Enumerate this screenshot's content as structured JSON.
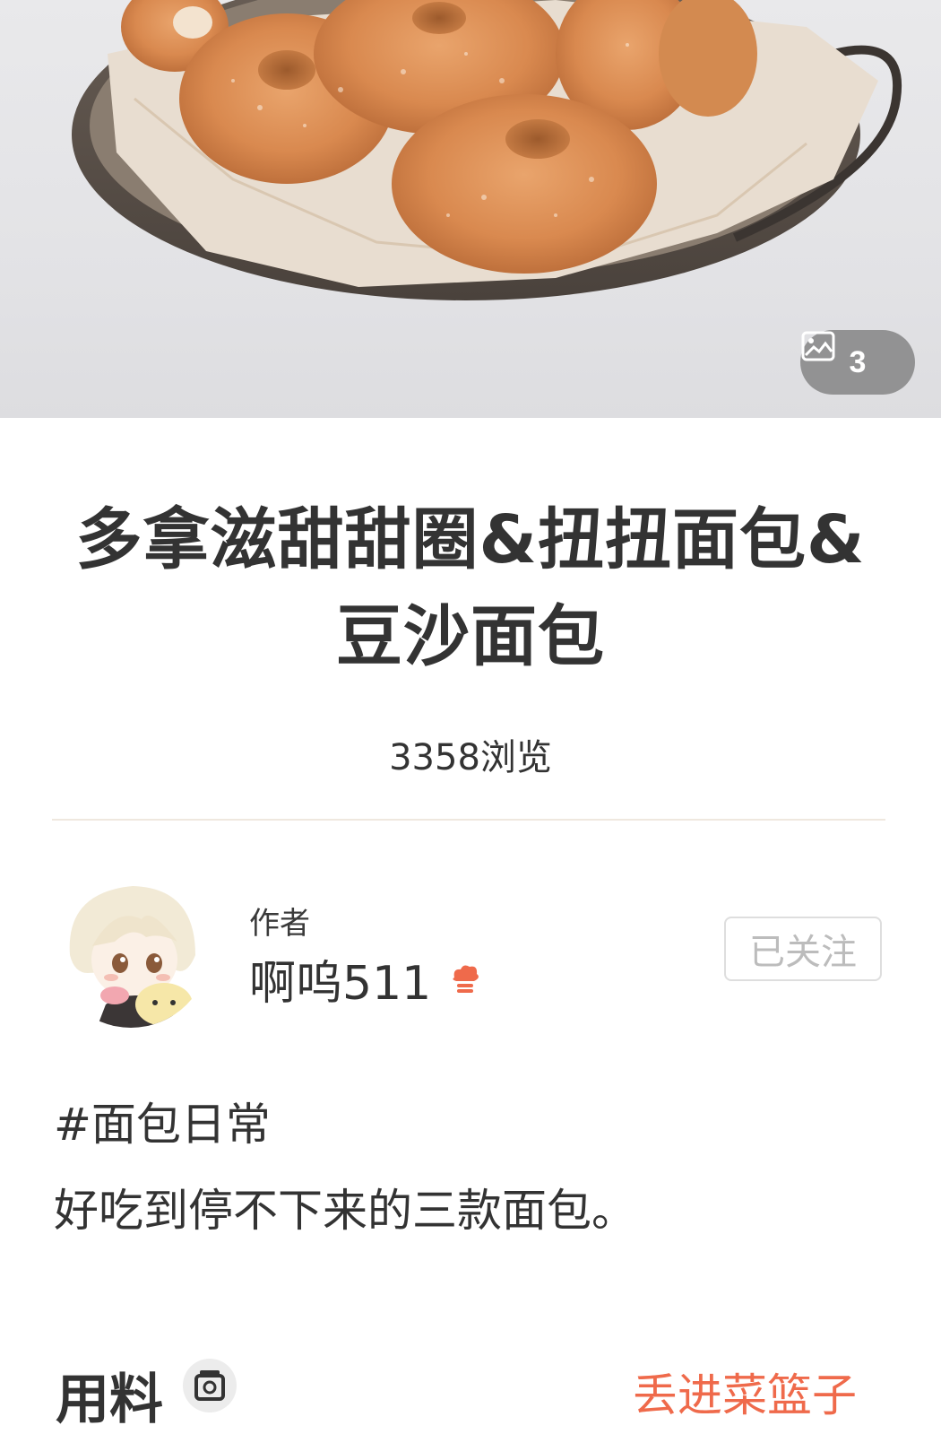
{
  "hero": {
    "image_count": "3",
    "icon": "image-gallery-icon"
  },
  "recipe": {
    "title_line1": "多拿滋甜甜圈&扭扭面包&",
    "title_line2": "豆沙面包",
    "views": "3358浏览"
  },
  "author": {
    "caption": "作者",
    "name": "啊呜511",
    "badge_icon": "chef-hat-icon",
    "follow_label": "已关注"
  },
  "description": {
    "tag": "#面包日常",
    "text": "好吃到停不下来的三款面包。"
  },
  "ingredients": {
    "title": "用料",
    "icon": "kitchen-scale-icon",
    "basket_link": "丢进菜篮子"
  },
  "colors": {
    "accent": "#ef6a4b",
    "text": "#333333",
    "follow_border": "#dedede",
    "follow_text": "#bcbcbc"
  }
}
